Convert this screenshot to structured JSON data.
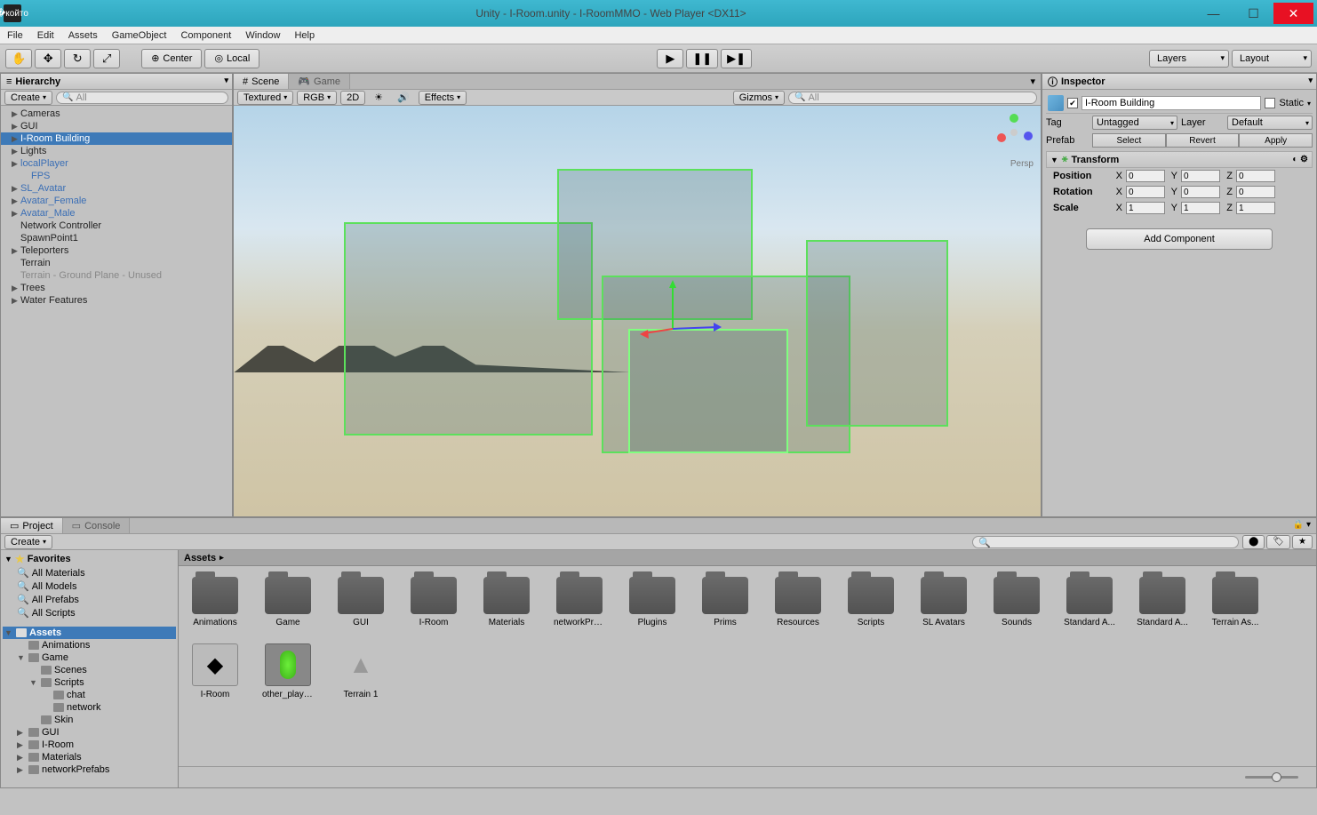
{
  "window": {
    "title": "Unity - I-Room.unity - I-RoomMMO - Web Player <DX11>"
  },
  "menu": [
    "File",
    "Edit",
    "Assets",
    "GameObject",
    "Component",
    "Window",
    "Help"
  ],
  "toolbar": {
    "center_btn": "Center",
    "local_btn": "Local",
    "layers": "Layers",
    "layout": "Layout"
  },
  "hierarchy": {
    "title": "Hierarchy",
    "create": "Create",
    "search_placeholder": "All",
    "items": [
      {
        "label": "Cameras",
        "arrow": true
      },
      {
        "label": "GUI",
        "arrow": true
      },
      {
        "label": "I-Room Building",
        "arrow": true,
        "selected": true
      },
      {
        "label": "Lights",
        "arrow": true
      },
      {
        "label": "localPlayer",
        "arrow": true,
        "blue": true
      },
      {
        "label": "FPS",
        "indent": 1,
        "blue": true
      },
      {
        "label": "SL_Avatar",
        "arrow": true,
        "blue": true
      },
      {
        "label": "Avatar_Female",
        "arrow": true,
        "blue": true
      },
      {
        "label": "Avatar_Male",
        "arrow": true,
        "blue": true
      },
      {
        "label": "Network Controller"
      },
      {
        "label": "SpawnPoint1"
      },
      {
        "label": "Teleporters",
        "arrow": true
      },
      {
        "label": "Terrain"
      },
      {
        "label": "Terrain - Ground Plane - Unused",
        "grey": true
      },
      {
        "label": "Trees",
        "arrow": true
      },
      {
        "label": "Water Features",
        "arrow": true
      }
    ]
  },
  "scene": {
    "tab_scene": "Scene",
    "tab_game": "Game",
    "textured": "Textured",
    "rgb": "RGB",
    "2d": "2D",
    "effects": "Effects",
    "gizmos": "Gizmos",
    "search_placeholder": "All",
    "persp": "Persp"
  },
  "inspector": {
    "title": "Inspector",
    "object_name": "I-Room Building",
    "static": "Static",
    "tag_label": "Tag",
    "tag_value": "Untagged",
    "layer_label": "Layer",
    "layer_value": "Default",
    "prefab_label": "Prefab",
    "select": "Select",
    "revert": "Revert",
    "apply": "Apply",
    "transform": "Transform",
    "position": "Position",
    "rotation": "Rotation",
    "scale": "Scale",
    "pos": {
      "x": "0",
      "y": "0",
      "z": "0"
    },
    "rot": {
      "x": "0",
      "y": "0",
      "z": "0"
    },
    "scl": {
      "x": "1",
      "y": "1",
      "z": "1"
    },
    "add_component": "Add Component"
  },
  "project": {
    "tab_project": "Project",
    "tab_console": "Console",
    "create": "Create",
    "favorites": "Favorites",
    "fav_items": [
      "All Materials",
      "All Models",
      "All Prefabs",
      "All Scripts"
    ],
    "assets_label": "Assets",
    "tree": [
      {
        "label": "Animations",
        "indent": 1
      },
      {
        "label": "Game",
        "indent": 1,
        "arrow": "down"
      },
      {
        "label": "Scenes",
        "indent": 2
      },
      {
        "label": "Scripts",
        "indent": 2,
        "arrow": "down"
      },
      {
        "label": "chat",
        "indent": 3
      },
      {
        "label": "network",
        "indent": 3
      },
      {
        "label": "Skin",
        "indent": 2
      },
      {
        "label": "GUI",
        "indent": 1,
        "arrow": "right"
      },
      {
        "label": "I-Room",
        "indent": 1,
        "arrow": "right"
      },
      {
        "label": "Materials",
        "indent": 1,
        "arrow": "right"
      },
      {
        "label": "networkPrefabs",
        "indent": 1,
        "arrow": "right"
      }
    ],
    "breadcrumb": "Assets",
    "grid": [
      {
        "label": "Animations",
        "type": "folder"
      },
      {
        "label": "Game",
        "type": "folder"
      },
      {
        "label": "GUI",
        "type": "folder"
      },
      {
        "label": "I-Room",
        "type": "folder"
      },
      {
        "label": "Materials",
        "type": "folder"
      },
      {
        "label": "networkPre...",
        "type": "folder"
      },
      {
        "label": "Plugins",
        "type": "folder"
      },
      {
        "label": "Prims",
        "type": "folder"
      },
      {
        "label": "Resources",
        "type": "folder"
      },
      {
        "label": "Scripts",
        "type": "folder"
      },
      {
        "label": "SL Avatars",
        "type": "folder"
      },
      {
        "label": "Sounds",
        "type": "folder"
      },
      {
        "label": "Standard A...",
        "type": "folder"
      },
      {
        "label": "Standard A...",
        "type": "folder"
      },
      {
        "label": "Terrain As...",
        "type": "folder"
      },
      {
        "label": "I-Room",
        "type": "unity"
      },
      {
        "label": "other_playe...",
        "type": "prefab"
      },
      {
        "label": "Terrain 1",
        "type": "terrain"
      }
    ]
  }
}
